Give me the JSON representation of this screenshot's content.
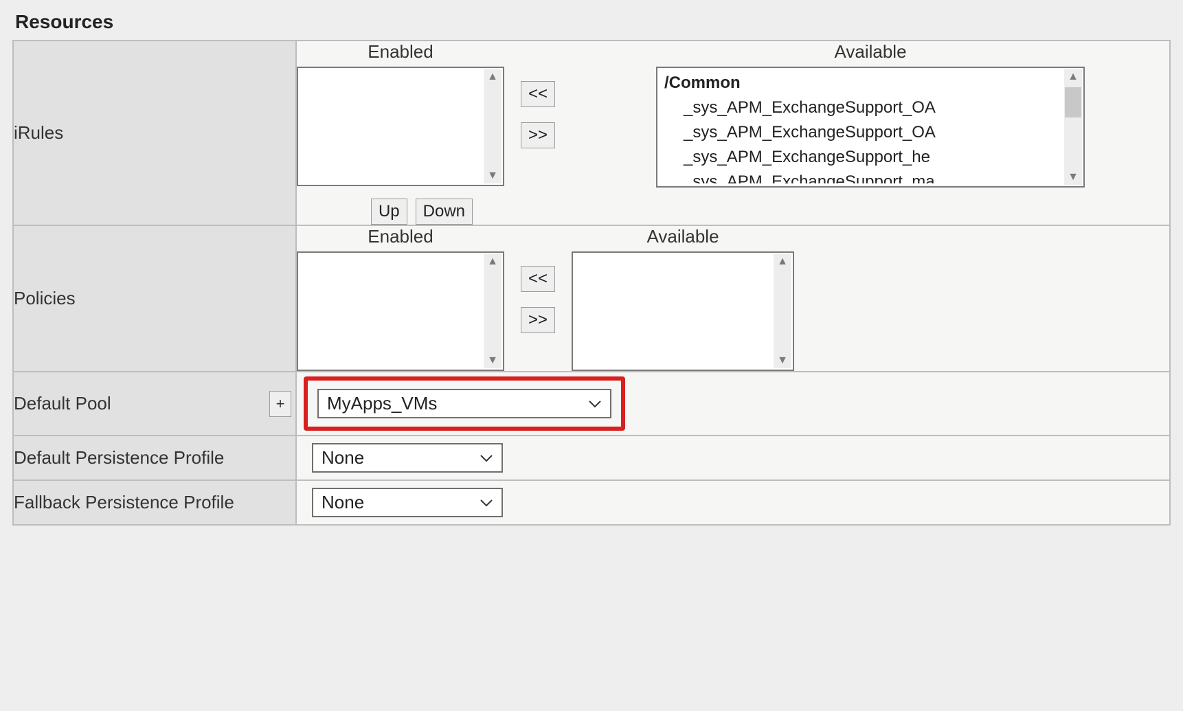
{
  "section_title": "Resources",
  "move_buttons": {
    "left": "<<",
    "right": ">>"
  },
  "order_buttons": {
    "up": "Up",
    "down": "Down"
  },
  "rows": {
    "irules": {
      "label": "iRules",
      "enabled_title": "Enabled",
      "available_title": "Available",
      "enabled_items": [],
      "available_group": "/Common",
      "available_items": [
        "_sys_APM_ExchangeSupport_OA",
        "_sys_APM_ExchangeSupport_OA",
        "_sys_APM_ExchangeSupport_he",
        "_sys_APM_ExchangeSupport_ma"
      ]
    },
    "policies": {
      "label": "Policies",
      "enabled_title": "Enabled",
      "available_title": "Available",
      "enabled_items": [],
      "available_items": []
    },
    "default_pool": {
      "label": "Default Pool",
      "plus_label": "+",
      "value": "MyApps_VMs"
    },
    "default_persistence": {
      "label": "Default Persistence Profile",
      "value": "None"
    },
    "fallback_persistence": {
      "label": "Fallback Persistence Profile",
      "value": "None"
    }
  }
}
